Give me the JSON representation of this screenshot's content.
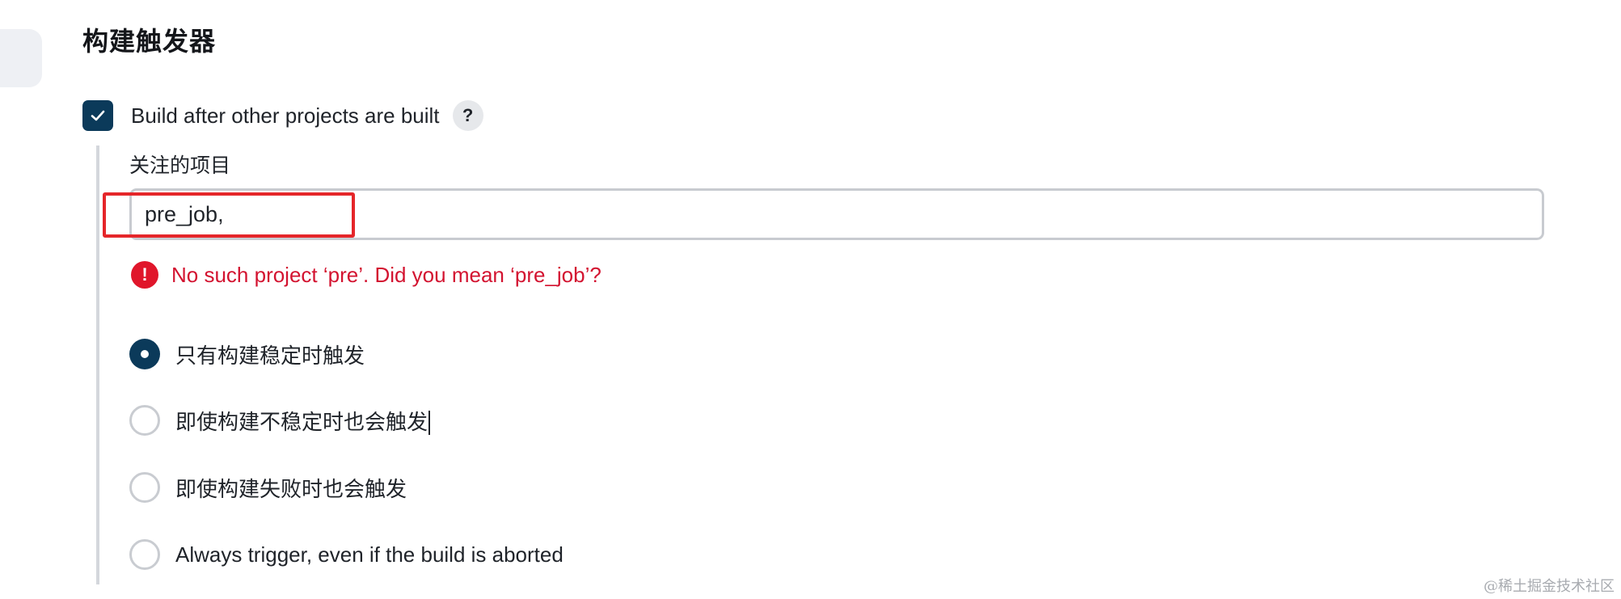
{
  "section": {
    "title": "构建触发器"
  },
  "trigger": {
    "label": "Build after other projects are built",
    "checked": true,
    "help_label": "?"
  },
  "watched_projects": {
    "label": "关注的项目",
    "value": "pre_job,"
  },
  "validation": {
    "icon_label": "!",
    "message": "No such project ‘pre’. Did you mean ‘pre_job’?"
  },
  "trigger_options": [
    {
      "label": "只有构建稳定时触发",
      "selected": true
    },
    {
      "label": "即使构建不稳定时也会触发",
      "selected": false
    },
    {
      "label": "即使构建失败时也会触发",
      "selected": false
    },
    {
      "label": "Always trigger, even if the build is aborted",
      "selected": false
    }
  ],
  "colors": {
    "accent": "#0b3a5a",
    "error": "#d31330",
    "highlight": "#e5262a"
  },
  "watermark": "@稀土掘金技术社区"
}
